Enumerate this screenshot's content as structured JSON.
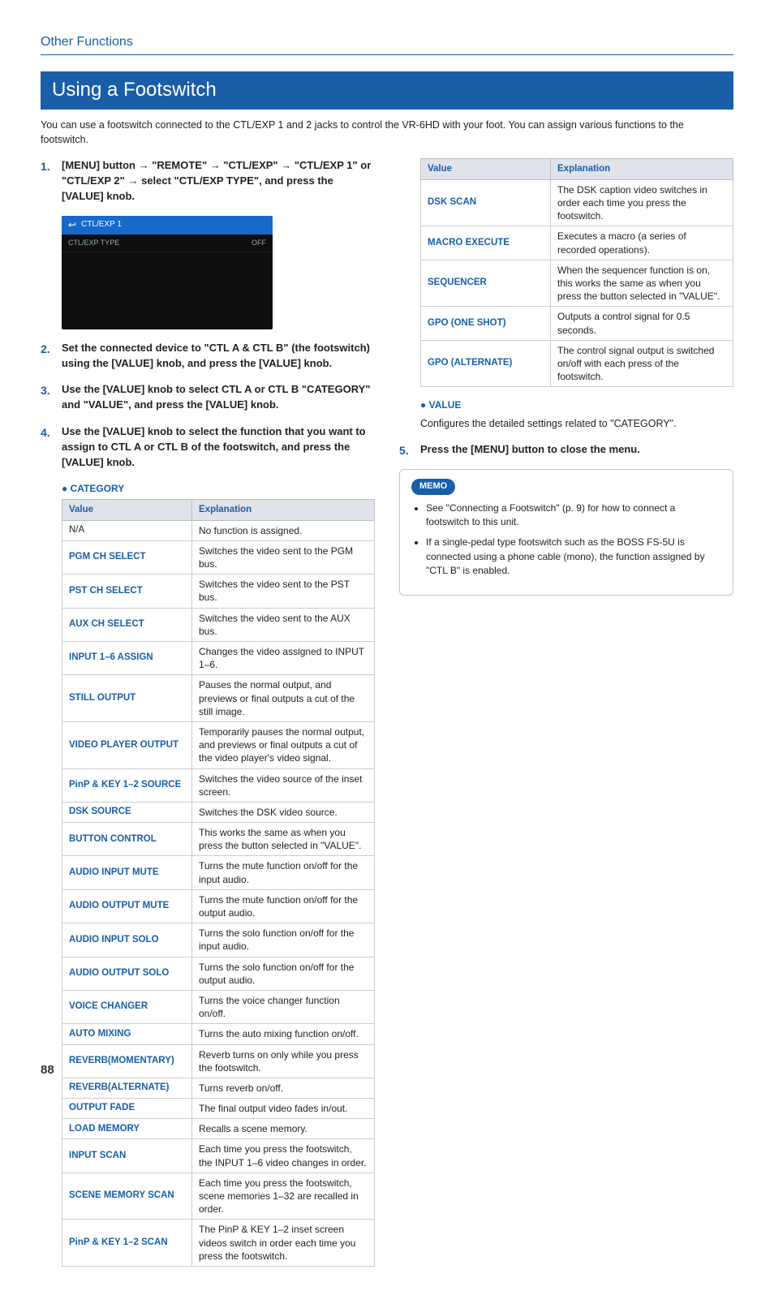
{
  "section_label": "Other Functions",
  "section_title": "Using a Footswitch",
  "intro": "You can use a footswitch connected to the CTL/EXP 1 and 2 jacks to control the VR-6HD with your foot. You can assign various functions to the footswitch.",
  "steps": {
    "s1_pre": "[MENU] button ",
    "s1_a": "→",
    "s1_mid1": " \"REMOTE\" ",
    "s1_mid2": " \"CTL/EXP\" ",
    "s1_mid3": " \"CTL/EXP 1\" or \"CTL/EXP 2\" ",
    "s1_post": " select \"CTL/EXP TYPE\", and press the [VALUE] knob.",
    "s2": "Set the connected device to \"CTL A & CTL B\" (the footswitch) using the [VALUE] knob, and press the [VALUE] knob.",
    "s3": "Use the [VALUE] knob to select CTL A or CTL B \"CATEGORY\" and \"VALUE\", and press the [VALUE] knob.",
    "s4": "Use the [VALUE] knob to select the function that you want to assign to CTL A or CTL B of the footswitch, and press the [VALUE] knob.",
    "s5": "Press the [MENU] button to close the menu."
  },
  "screenshot": {
    "header_icon": "↩",
    "header_text": "CTL/EXP 1",
    "row_label": "CTL/EXP TYPE",
    "row_value": "OFF"
  },
  "cat_label_category": "CATEGORY",
  "cat_label_value": "VALUE",
  "value_desc": "Configures the detailed settings related to \"CATEGORY\".",
  "headers": {
    "value": "Value",
    "explanation": "Explanation"
  },
  "category": [
    {
      "v": "N/A",
      "e": "No function is assigned.",
      "na": true
    },
    {
      "v": "PGM CH SELECT",
      "e": "Switches the video sent to the PGM bus."
    },
    {
      "v": "PST CH SELECT",
      "e": "Switches the video sent to the PST bus."
    },
    {
      "v": "AUX CH SELECT",
      "e": "Switches the video sent to the AUX bus."
    },
    {
      "v": "INPUT 1–6 ASSIGN",
      "e": "Changes the video assigned to INPUT 1–6."
    },
    {
      "v": "STILL OUTPUT",
      "e": "Pauses the normal output, and previews or final outputs a cut of the still image."
    },
    {
      "v": "VIDEO PLAYER OUTPUT",
      "e": "Temporarily pauses the normal output, and previews or final outputs a cut of the video player's video signal."
    },
    {
      "v": "PinP & KEY 1–2 SOURCE",
      "e": "Switches the video source of the inset screen."
    },
    {
      "v": "DSK SOURCE",
      "e": "Switches the DSK video source."
    },
    {
      "v": "BUTTON CONTROL",
      "e": "This works the same as when you press the button selected in \"VALUE\"."
    },
    {
      "v": "AUDIO INPUT MUTE",
      "e": "Turns the mute function on/off for the input audio."
    },
    {
      "v": "AUDIO OUTPUT MUTE",
      "e": "Turns the mute function on/off for the output audio."
    },
    {
      "v": "AUDIO INPUT SOLO",
      "e": "Turns the solo function on/off for the input audio."
    },
    {
      "v": "AUDIO OUTPUT SOLO",
      "e": "Turns the solo function on/off for the output audio."
    },
    {
      "v": "VOICE CHANGER",
      "e": "Turns the voice changer function on/off."
    },
    {
      "v": "AUTO MIXING",
      "e": "Turns the auto mixing function on/off."
    },
    {
      "v": "REVERB(MOMENTARY)",
      "e": "Reverb turns on only while you press the footswitch."
    },
    {
      "v": "REVERB(ALTERNATE)",
      "e": "Turns reverb on/off."
    },
    {
      "v": "OUTPUT FADE",
      "e": "The final output video fades in/out."
    },
    {
      "v": "LOAD MEMORY",
      "e": "Recalls a scene memory."
    },
    {
      "v": "INPUT SCAN",
      "e": "Each time you press the footswitch, the INPUT 1–6 video changes in order."
    },
    {
      "v": "SCENE MEMORY SCAN",
      "e": "Each time you press the footswitch, scene memories 1–32 are recalled in order."
    },
    {
      "v": "PinP & KEY 1–2 SCAN",
      "e": "The PinP & KEY 1–2 inset screen videos switch in order each time you press the footswitch."
    }
  ],
  "category_cont": [
    {
      "v": "DSK SCAN",
      "e": "The DSK caption video switches in order each time you press the footswitch."
    },
    {
      "v": "MACRO EXECUTE",
      "e": "Executes a macro (a series of recorded operations)."
    },
    {
      "v": "SEQUENCER",
      "e": "When the sequencer function is on, this works the same as when you press the button selected in \"VALUE\"."
    },
    {
      "v": "GPO (ONE SHOT)",
      "e": "Outputs a control signal for 0.5 seconds."
    },
    {
      "v": "GPO (ALTERNATE)",
      "e": "The control signal output is switched on/off with each press of the footswitch."
    }
  ],
  "memo": {
    "badge": "MEMO",
    "items": [
      "See \"Connecting a Footswitch\" (p. 9) for how to connect a footswitch to this unit.",
      "If a single-pedal type footswitch such as the BOSS FS-5U is connected using a phone cable (mono), the function assigned by \"CTL B\" is enabled."
    ]
  },
  "page": "88"
}
